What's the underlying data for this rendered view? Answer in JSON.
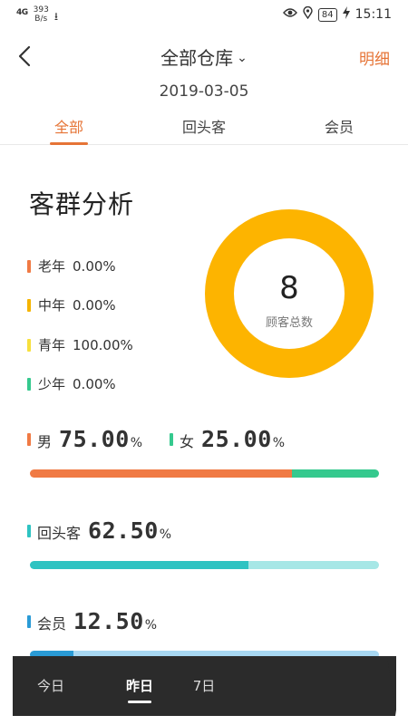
{
  "status_bar": {
    "signal": "4G",
    "speed_value": "393",
    "speed_unit": "B/s",
    "usb": "⭳",
    "battery": "84",
    "time": "15:11"
  },
  "nav": {
    "title": "全部仓库",
    "detail": "明细"
  },
  "date": "2019-03-05",
  "tabs": [
    {
      "label": "全部",
      "active": true
    },
    {
      "label": "回头客",
      "active": false
    },
    {
      "label": "会员",
      "active": false
    }
  ],
  "analysis": {
    "title": "客群分析",
    "age_groups": [
      {
        "label": "老年",
        "value": "0.00%",
        "color": "#f07a44"
      },
      {
        "label": "中年",
        "value": "0.00%",
        "color": "#f5b400"
      },
      {
        "label": "青年",
        "value": "100.00%",
        "color": "#f7e03c"
      },
      {
        "label": "少年",
        "value": "0.00%",
        "color": "#35c98e"
      }
    ],
    "donut": {
      "total": "8",
      "label": "顾客总数",
      "color": "#fdb400",
      "fraction": 1.0
    }
  },
  "gender": {
    "male": {
      "label": "男",
      "value": "75.00",
      "unit": "%",
      "color": "#f07a44"
    },
    "female": {
      "label": "女",
      "value": "25.00",
      "unit": "%",
      "color": "#35c98e"
    },
    "male_fraction": 0.75
  },
  "returning": {
    "label": "回头客",
    "value": "62.50",
    "unit": "%",
    "color": "#2ec3c2",
    "rest_color": "#a6e7e6",
    "fraction": 0.625
  },
  "member": {
    "label": "会员",
    "value": "12.50",
    "unit": "%",
    "color": "#2a9bd6",
    "rest_color": "#a8d8f2",
    "fraction": 0.125
  },
  "bottom_tabs": [
    {
      "label": "今日",
      "active": false
    },
    {
      "label": "昨日",
      "active": true
    },
    {
      "label": "7日",
      "active": false
    }
  ]
}
